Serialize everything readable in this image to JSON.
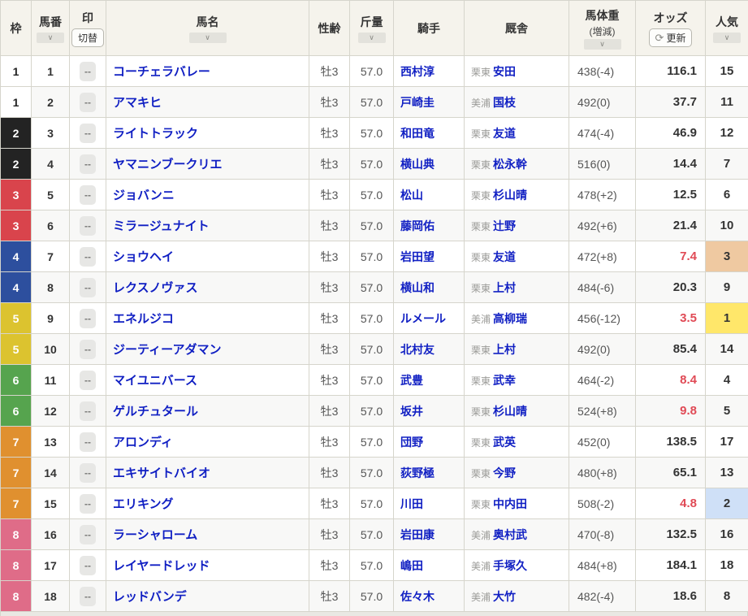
{
  "icons": {
    "chevron_down": "∨",
    "refresh": "⟳"
  },
  "colors": {
    "link": "#101fc3",
    "odds_hot": "#e04a55",
    "header_bg": "#f5f3ec",
    "frame": {
      "1": [
        "#ffffff",
        "#222222"
      ],
      "2": [
        "#232323",
        "#ffffff"
      ],
      "3": [
        "#d9444c",
        "#ffffff"
      ],
      "4": [
        "#2d4f9e",
        "#ffffff"
      ],
      "5": [
        "#dcc32f",
        "#ffffff"
      ],
      "6": [
        "#56a44e",
        "#ffffff"
      ],
      "7": [
        "#e0902f",
        "#ffffff"
      ],
      "8": [
        "#df6c88",
        "#ffffff"
      ]
    },
    "pop_highlight": {
      "1": "#ffe76a",
      "2": "#cfe0f7",
      "3": "#efc9a1"
    }
  },
  "table": {
    "header": {
      "frame": "枠",
      "num": "馬番",
      "mark": "印",
      "mark_button": "切替",
      "name": "馬名",
      "sex_age": "性齢",
      "weight": "斤量",
      "jockey": "騎手",
      "stable": "厩舎",
      "body_weight": "馬体重",
      "body_weight_sub": "(増減)",
      "odds": "オッズ",
      "odds_button": "更新",
      "popularity": "人気"
    },
    "rows": [
      {
        "frame": "1",
        "num": "1",
        "mark": "--",
        "name": "コーチェラバレー",
        "sex_age": "牡3",
        "weight": "57.0",
        "jockey": "西村淳",
        "region": "栗東",
        "trainer": "安田",
        "body_weight": "438(-4)",
        "odds": "116.1",
        "odds_hot": false,
        "popularity": "15",
        "pop_highlight": null
      },
      {
        "frame": "1",
        "num": "2",
        "mark": "--",
        "name": "アマキヒ",
        "sex_age": "牡3",
        "weight": "57.0",
        "jockey": "戸崎圭",
        "region": "美浦",
        "trainer": "国枝",
        "body_weight": "492(0)",
        "odds": "37.7",
        "odds_hot": false,
        "popularity": "11",
        "pop_highlight": null
      },
      {
        "frame": "2",
        "num": "3",
        "mark": "--",
        "name": "ライトトラック",
        "sex_age": "牡3",
        "weight": "57.0",
        "jockey": "和田竜",
        "region": "栗東",
        "trainer": "友道",
        "body_weight": "474(-4)",
        "odds": "46.9",
        "odds_hot": false,
        "popularity": "12",
        "pop_highlight": null
      },
      {
        "frame": "2",
        "num": "4",
        "mark": "--",
        "name": "ヤマニンブークリエ",
        "sex_age": "牡3",
        "weight": "57.0",
        "jockey": "横山典",
        "region": "栗東",
        "trainer": "松永幹",
        "body_weight": "516(0)",
        "odds": "14.4",
        "odds_hot": false,
        "popularity": "7",
        "pop_highlight": null
      },
      {
        "frame": "3",
        "num": "5",
        "mark": "--",
        "name": "ジョバンニ",
        "sex_age": "牡3",
        "weight": "57.0",
        "jockey": "松山",
        "region": "栗東",
        "trainer": "杉山晴",
        "body_weight": "478(+2)",
        "odds": "12.5",
        "odds_hot": false,
        "popularity": "6",
        "pop_highlight": null
      },
      {
        "frame": "3",
        "num": "6",
        "mark": "--",
        "name": "ミラージュナイト",
        "sex_age": "牡3",
        "weight": "57.0",
        "jockey": "藤岡佑",
        "region": "栗東",
        "trainer": "辻野",
        "body_weight": "492(+6)",
        "odds": "21.4",
        "odds_hot": false,
        "popularity": "10",
        "pop_highlight": null
      },
      {
        "frame": "4",
        "num": "7",
        "mark": "--",
        "name": "ショウヘイ",
        "sex_age": "牡3",
        "weight": "57.0",
        "jockey": "岩田望",
        "region": "栗東",
        "trainer": "友道",
        "body_weight": "472(+8)",
        "odds": "7.4",
        "odds_hot": true,
        "popularity": "3",
        "pop_highlight": "3"
      },
      {
        "frame": "4",
        "num": "8",
        "mark": "--",
        "name": "レクスノヴァス",
        "sex_age": "牡3",
        "weight": "57.0",
        "jockey": "横山和",
        "region": "栗東",
        "trainer": "上村",
        "body_weight": "484(-6)",
        "odds": "20.3",
        "odds_hot": false,
        "popularity": "9",
        "pop_highlight": null
      },
      {
        "frame": "5",
        "num": "9",
        "mark": "--",
        "name": "エネルジコ",
        "sex_age": "牡3",
        "weight": "57.0",
        "jockey": "ルメール",
        "region": "美浦",
        "trainer": "高柳瑞",
        "body_weight": "456(-12)",
        "odds": "3.5",
        "odds_hot": true,
        "popularity": "1",
        "pop_highlight": "1"
      },
      {
        "frame": "5",
        "num": "10",
        "mark": "--",
        "name": "ジーティーアダマン",
        "sex_age": "牡3",
        "weight": "57.0",
        "jockey": "北村友",
        "region": "栗東",
        "trainer": "上村",
        "body_weight": "492(0)",
        "odds": "85.4",
        "odds_hot": false,
        "popularity": "14",
        "pop_highlight": null
      },
      {
        "frame": "6",
        "num": "11",
        "mark": "--",
        "name": "マイユニバース",
        "sex_age": "牡3",
        "weight": "57.0",
        "jockey": "武豊",
        "region": "栗東",
        "trainer": "武幸",
        "body_weight": "464(-2)",
        "odds": "8.4",
        "odds_hot": true,
        "popularity": "4",
        "pop_highlight": null
      },
      {
        "frame": "6",
        "num": "12",
        "mark": "--",
        "name": "ゲルチュタール",
        "sex_age": "牡3",
        "weight": "57.0",
        "jockey": "坂井",
        "region": "栗東",
        "trainer": "杉山晴",
        "body_weight": "524(+8)",
        "odds": "9.8",
        "odds_hot": true,
        "popularity": "5",
        "pop_highlight": null
      },
      {
        "frame": "7",
        "num": "13",
        "mark": "--",
        "name": "アロンディ",
        "sex_age": "牡3",
        "weight": "57.0",
        "jockey": "団野",
        "region": "栗東",
        "trainer": "武英",
        "body_weight": "452(0)",
        "odds": "138.5",
        "odds_hot": false,
        "popularity": "17",
        "pop_highlight": null
      },
      {
        "frame": "7",
        "num": "14",
        "mark": "--",
        "name": "エキサイトバイオ",
        "sex_age": "牡3",
        "weight": "57.0",
        "jockey": "荻野極",
        "region": "栗東",
        "trainer": "今野",
        "body_weight": "480(+8)",
        "odds": "65.1",
        "odds_hot": false,
        "popularity": "13",
        "pop_highlight": null
      },
      {
        "frame": "7",
        "num": "15",
        "mark": "--",
        "name": "エリキング",
        "sex_age": "牡3",
        "weight": "57.0",
        "jockey": "川田",
        "region": "栗東",
        "trainer": "中内田",
        "body_weight": "508(-2)",
        "odds": "4.8",
        "odds_hot": true,
        "popularity": "2",
        "pop_highlight": "2"
      },
      {
        "frame": "8",
        "num": "16",
        "mark": "--",
        "name": "ラーシャローム",
        "sex_age": "牡3",
        "weight": "57.0",
        "jockey": "岩田康",
        "region": "美浦",
        "trainer": "奥村武",
        "body_weight": "470(-8)",
        "odds": "132.5",
        "odds_hot": false,
        "popularity": "16",
        "pop_highlight": null
      },
      {
        "frame": "8",
        "num": "17",
        "mark": "--",
        "name": "レイヤードレッド",
        "sex_age": "牡3",
        "weight": "57.0",
        "jockey": "嶋田",
        "region": "美浦",
        "trainer": "手塚久",
        "body_weight": "484(+8)",
        "odds": "184.1",
        "odds_hot": false,
        "popularity": "18",
        "pop_highlight": null
      },
      {
        "frame": "8",
        "num": "18",
        "mark": "--",
        "name": "レッドバンデ",
        "sex_age": "牡3",
        "weight": "57.0",
        "jockey": "佐々木",
        "region": "美浦",
        "trainer": "大竹",
        "body_weight": "482(-4)",
        "odds": "18.6",
        "odds_hot": false,
        "popularity": "8",
        "pop_highlight": null
      }
    ]
  }
}
